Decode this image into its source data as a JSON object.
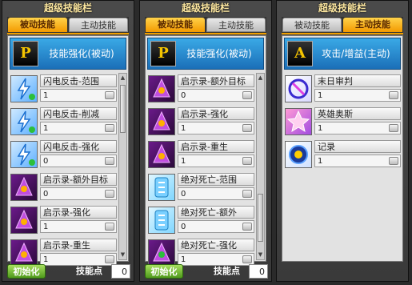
{
  "panels": [
    {
      "title": "超级技能栏",
      "tabs": {
        "passive": "被动技能",
        "active": "主动技能",
        "selected": "passive"
      },
      "header": {
        "badge": "P",
        "label": "技能强化(被动)"
      },
      "skills": [
        {
          "name": "闪电反击-范围",
          "level": "1",
          "icon": "lightning"
        },
        {
          "name": "闪电反击-削减",
          "level": "1",
          "icon": "lightning"
        },
        {
          "name": "闪电反击-强化",
          "level": "0",
          "icon": "lightning"
        },
        {
          "name": "启示录-额外目标",
          "level": "0",
          "icon": "apoc"
        },
        {
          "name": "启示录-强化",
          "level": "1",
          "icon": "apoc"
        },
        {
          "name": "启示录-重生",
          "level": "1",
          "icon": "apoc"
        }
      ],
      "footer": {
        "init_label": "初始化",
        "sp_label": "技能点",
        "sp_value": "0"
      }
    },
    {
      "title": "超级技能栏",
      "tabs": {
        "passive": "被动技能",
        "active": "主动技能",
        "selected": "passive"
      },
      "header": {
        "badge": "P",
        "label": "技能强化(被动)"
      },
      "skills": [
        {
          "name": "启示录-额外目标",
          "level": "0",
          "icon": "apoc"
        },
        {
          "name": "启示录-强化",
          "level": "1",
          "icon": "apoc"
        },
        {
          "name": "启示录-重生",
          "level": "1",
          "icon": "apoc"
        },
        {
          "name": "绝对死亡-范围",
          "level": "0",
          "icon": "death"
        },
        {
          "name": "绝对死亡-额外",
          "level": "0",
          "icon": "death"
        },
        {
          "name": "绝对死亡-强化",
          "level": "1",
          "icon": "death"
        }
      ],
      "footer": {
        "init_label": "初始化",
        "sp_label": "技能点",
        "sp_value": "0"
      }
    },
    {
      "title": "超级技能栏",
      "tabs": {
        "passive": "被动技能",
        "active": "主动技能",
        "selected": "active"
      },
      "header": {
        "badge": "A",
        "label": "攻击/增益(主动)"
      },
      "skills": [
        {
          "name": "末日审判",
          "level": "1",
          "icon": "judg"
        },
        {
          "name": "英雄奥斯",
          "level": "1",
          "icon": "hero"
        },
        {
          "name": "记录",
          "level": "1",
          "icon": "rec"
        }
      ],
      "footer": {
        "init_label": "",
        "sp_label": "",
        "sp_value": ""
      }
    }
  ],
  "colors": {
    "tab_active": "#f39a00",
    "header_blue": "#1b6fb8",
    "init_green": "#4f9a1c",
    "panel_bg": "#3a3a3a"
  },
  "icons": {
    "lightning": "lightning-skill-icon",
    "apoc": "apocalypse-skill-icon",
    "death": "absolute-death-skill-icon",
    "judg": "doomsday-judgment-icon",
    "hero": "hero-oath-icon",
    "rec": "record-icon"
  }
}
